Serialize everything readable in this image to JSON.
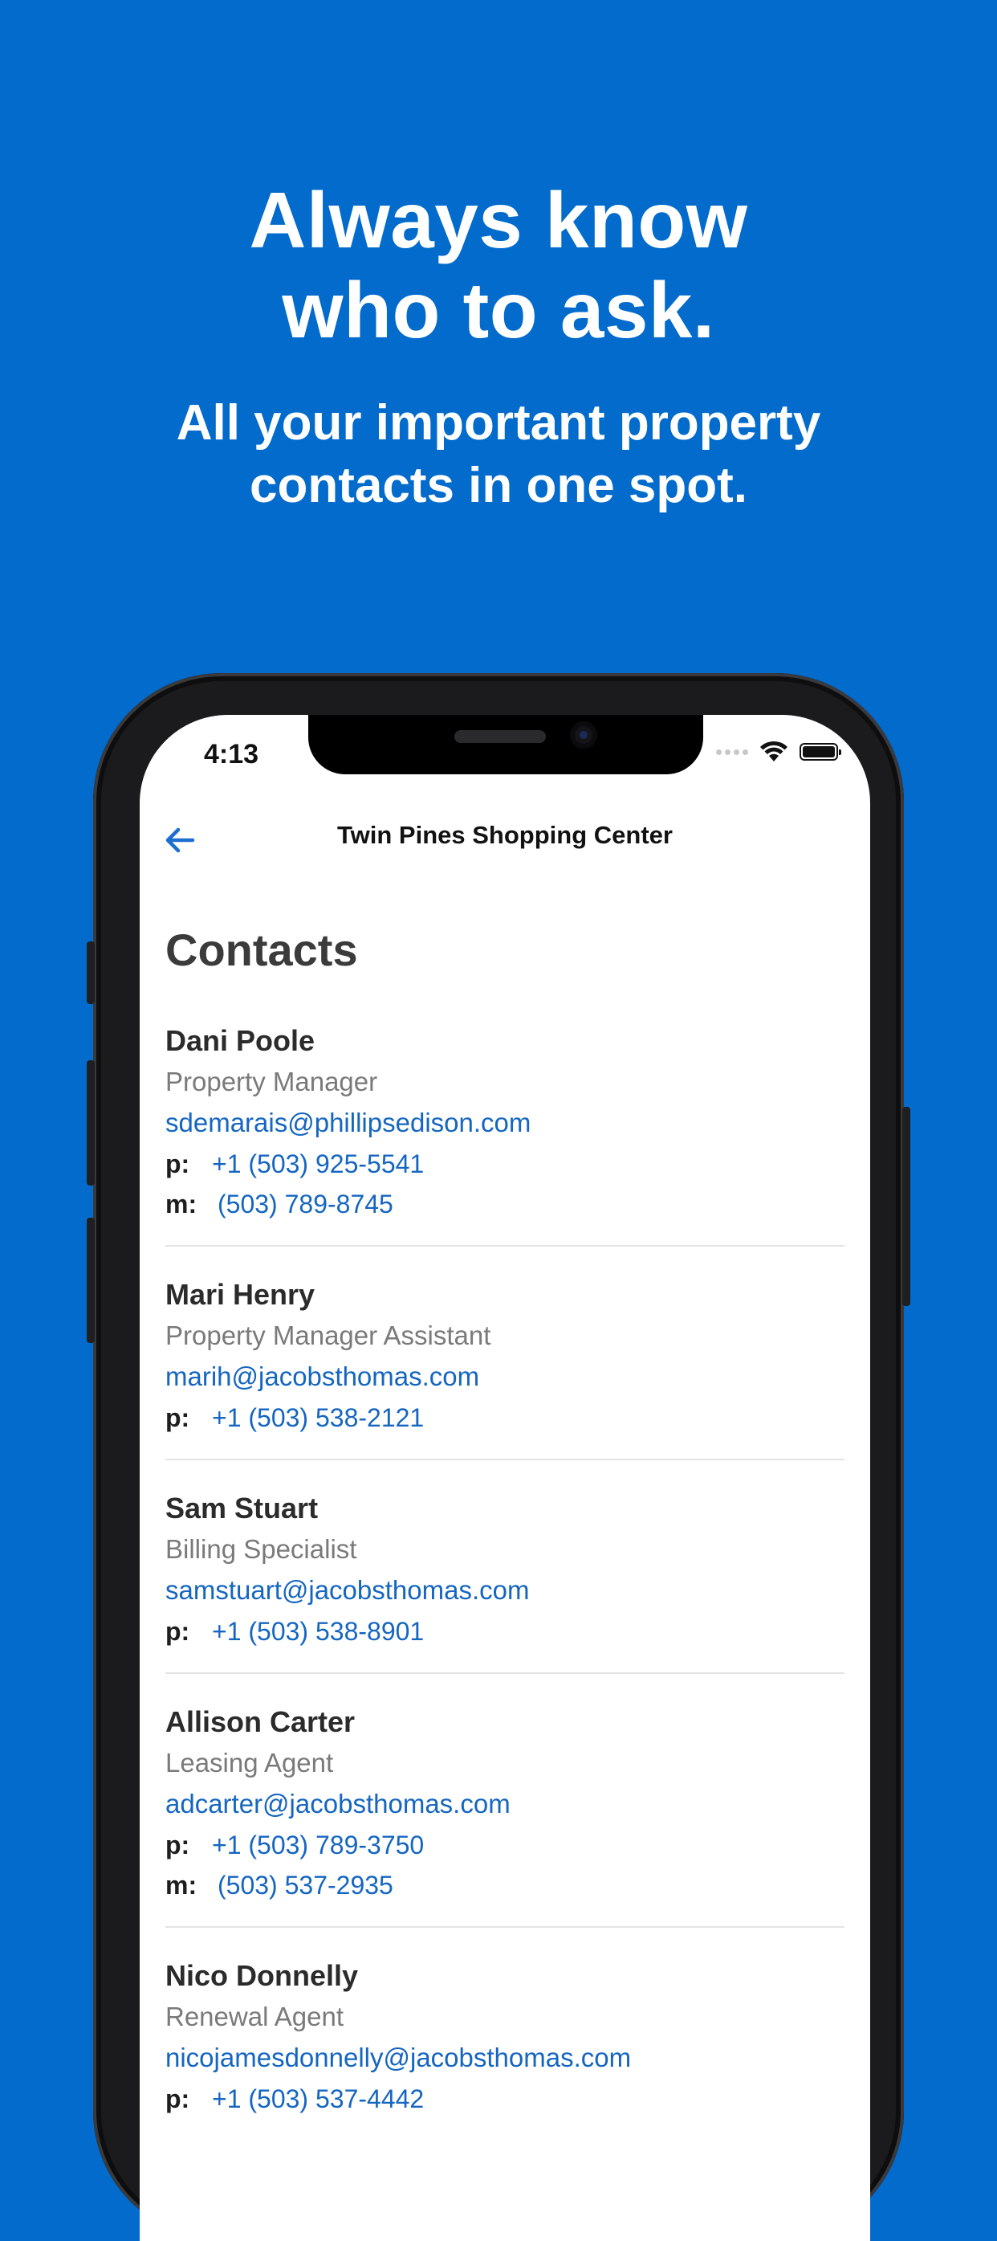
{
  "hero": {
    "title_line1": "Always know",
    "title_line2": "who to ask.",
    "subtitle_line1": "All your important property",
    "subtitle_line2": "contacts in one spot."
  },
  "status_bar": {
    "time": "4:13",
    "icons": [
      "signal-dots-icon",
      "wifi-icon",
      "battery-icon"
    ]
  },
  "nav": {
    "back_icon": "back-arrow-icon",
    "title": "Twin Pines Shopping Center"
  },
  "page": {
    "title": "Contacts"
  },
  "contacts": [
    {
      "name": "Dani Poole",
      "role": "Property Manager",
      "email": "sdemarais@phillipsedison.com",
      "phone_label": "p:",
      "phone": "+1 (503) 925-5541",
      "mobile_label": "m:",
      "mobile": "(503) 789-8745"
    },
    {
      "name": "Mari Henry",
      "role": "Property Manager Assistant",
      "email": "marih@jacobsthomas.com",
      "phone_label": "p:",
      "phone": "+1 (503) 538-2121"
    },
    {
      "name": "Sam Stuart",
      "role": "Billing Specialist",
      "email": "samstuart@jacobsthomas.com",
      "phone_label": "p:",
      "phone": "+1 (503) 538-8901"
    },
    {
      "name": "Allison Carter",
      "role": "Leasing Agent",
      "email": "adcarter@jacobsthomas.com",
      "phone_label": "p:",
      "phone": "+1 (503) 789-3750",
      "mobile_label": "m:",
      "mobile": "(503) 537-2935"
    },
    {
      "name": "Nico Donnelly",
      "role": "Renewal Agent",
      "email": "nicojamesdonnelly@jacobsthomas.com",
      "phone_label": "p:",
      "phone": "+1 (503) 537-4442"
    }
  ],
  "colors": {
    "background": "#026bcb",
    "link": "#1566c1",
    "back_arrow": "#1a6fd0"
  }
}
